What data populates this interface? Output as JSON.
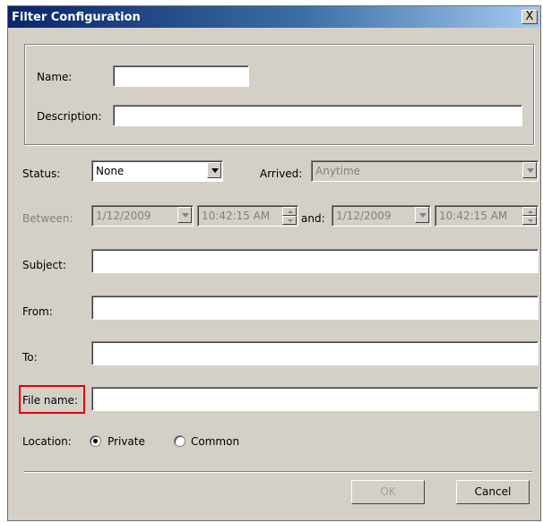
{
  "window": {
    "title": "Filter Configuration",
    "close_glyph": "X"
  },
  "identity": {
    "name_label": "Name:",
    "name_value": "",
    "description_label": "Description:",
    "description_value": ""
  },
  "status": {
    "label": "Status:",
    "value": "None"
  },
  "arrived": {
    "label": "Arrived:",
    "value": "Anytime"
  },
  "between": {
    "label": "Between:",
    "start_date": "1/12/2009",
    "start_time": "10:42:15 AM",
    "and_label": "and:",
    "end_date": "1/12/2009",
    "end_time": "10:42:15 AM"
  },
  "subject": {
    "label": "Subject:",
    "value": ""
  },
  "from": {
    "label": "From:",
    "value": ""
  },
  "to": {
    "label": "To:",
    "value": ""
  },
  "file_name": {
    "label": "File name:",
    "value": ""
  },
  "location": {
    "label": "Location:",
    "options": [
      {
        "label": "Private",
        "selected": true
      },
      {
        "label": "Common",
        "selected": false
      }
    ]
  },
  "buttons": {
    "ok": "OK",
    "cancel": "Cancel"
  },
  "colors": {
    "titlebar": "#0a246a",
    "dialog_bg": "#d4d0c8",
    "highlight_box": "#e00000"
  }
}
